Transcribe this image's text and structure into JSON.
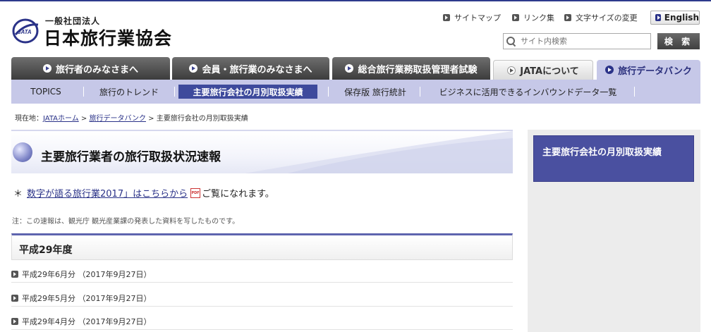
{
  "logo": {
    "small": "一般社団法人",
    "big": "日本旅行業協会",
    "mark_text": "JATA"
  },
  "utility": {
    "sitemap": "サイトマップ",
    "links": "リンク集",
    "font_size": "文字サイズの変更",
    "english": "English"
  },
  "search": {
    "placeholder": "サイト内検索",
    "button": "検 索"
  },
  "gnav": [
    {
      "label": "旅行者のみなさまへ"
    },
    {
      "label": "会員・旅行業のみなさまへ"
    },
    {
      "label": "総合旅行業務取扱管理者試験"
    },
    {
      "label": "JATAについて"
    },
    {
      "label": "旅行データバンク"
    }
  ],
  "subnav": [
    {
      "label": "TOPICS"
    },
    {
      "label": "旅行のトレンド"
    },
    {
      "label": "主要旅行会社の月別取扱実績"
    },
    {
      "label": "保存版 旅行統計"
    },
    {
      "label": "ビジネスに活用できるインバウンドデータ一覧"
    }
  ],
  "breadcrumb": {
    "prefix": "現在地：",
    "home": "JATAホーム",
    "sep1": " > ",
    "databank": "旅行データバンク",
    "sep2": " > ",
    "current": "主要旅行会社の月別取扱実績"
  },
  "main": {
    "title": "主要旅行業者の旅行取扱状況速報",
    "notice_mark": "＊",
    "notice_link": "数字が語る旅行業2017」はこちらから",
    "pdf_label": "PDF",
    "notice_tail": "ご覧になれます。",
    "note": "注：この速報は、観光庁 観光産業課の発表した資料を写したものです。",
    "year": "平成29年度",
    "reports": [
      {
        "label": "平成29年6月分 （2017年9月27日）"
      },
      {
        "label": "平成29年5月分 （2017年9月27日）"
      },
      {
        "label": "平成29年4月分 （2017年9月27日）"
      }
    ]
  },
  "sidebar": {
    "title": "主要旅行会社の月別取扱実績"
  },
  "colors": {
    "brand": "#2a3288",
    "subnav_bg": "#c6c8e8",
    "selected_sub": "#3e4a9c",
    "sidebar_title": "#4a50a0"
  }
}
